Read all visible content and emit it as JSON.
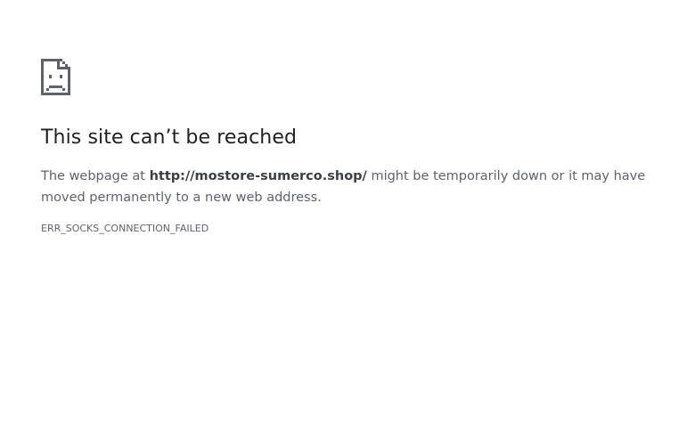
{
  "error_page": {
    "icon": "sad-page-icon",
    "title": "This site can’t be reached",
    "message_prefix": "The webpage at ",
    "url": "http://mostore-sumerco.shop/",
    "message_suffix": " might be temporarily down or it may have moved permanently to a new web address.",
    "error_code": "ERR_SOCKS_CONNECTION_FAILED"
  },
  "colors": {
    "background": "#ffffff",
    "title": "#202124",
    "body_text": "#5f6368",
    "icon": "#5f6368"
  }
}
